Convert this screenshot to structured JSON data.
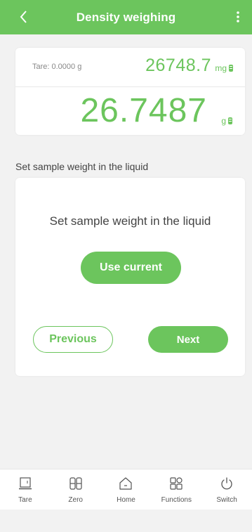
{
  "header": {
    "title": "Density weighing",
    "back_icon": "chevron-left-icon",
    "menu_icon": "more-vertical-icon",
    "color": "#6cc55d"
  },
  "weight": {
    "tare": "Tare: 0.0000 g",
    "mg_value": "26748.7",
    "mg_unit": "mg",
    "g_value": "26.7487",
    "g_unit": "g"
  },
  "section_label": "Set sample weight in the liquid",
  "step": {
    "text": "Set sample weight in the liquid",
    "use_current_label": "Use current",
    "previous_label": "Previous",
    "next_label": "Next"
  },
  "nav": {
    "items": [
      {
        "label": "Tare",
        "icon": "tare-icon"
      },
      {
        "label": "Zero",
        "icon": "zero-icon"
      },
      {
        "label": "Home",
        "icon": "home-icon"
      },
      {
        "label": "Functions",
        "icon": "functions-icon"
      },
      {
        "label": "Switch",
        "icon": "power-icon"
      }
    ]
  }
}
